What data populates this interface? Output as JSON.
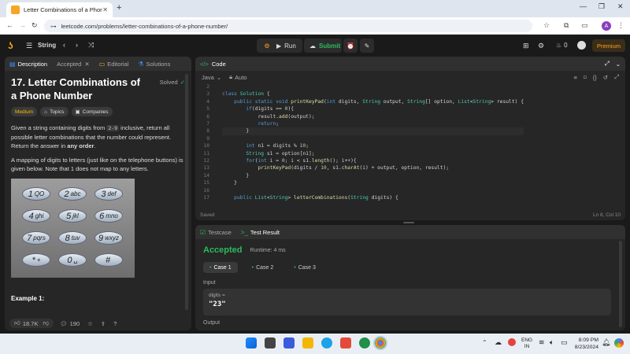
{
  "browser": {
    "tab_title": "Letter Combinations of a Phone",
    "url": "leetcode.com/problems/letter-combinations-of-a-phone-number/"
  },
  "nav": {
    "problem_list": "String",
    "run": "Run",
    "submit": "Submit",
    "streak": "0",
    "premium": "Premium",
    "avatar": "A"
  },
  "left_tabs": [
    "Description",
    "Accepted",
    "Editorial",
    "Solutions"
  ],
  "problem": {
    "title": "17. Letter Combinations of a Phone Number",
    "status": "Solved",
    "difficulty": "Medium",
    "topics": "Topics",
    "companies": "Companies",
    "p1a": "Given a string containing digits from ",
    "p1code": "2-9",
    "p1b": " inclusive, return all possible letter combinations that the number could represent. Return the answer in ",
    "p1c": "any order",
    "p1d": ".",
    "p2": "A mapping of digits to letters (just like on the telephone buttons) is given below. Note that 1 does not map to any letters.",
    "example": "Example 1:"
  },
  "keypad": [
    [
      "1",
      "QO"
    ],
    [
      "2",
      "abc"
    ],
    [
      "3",
      "def"
    ],
    [
      "4",
      "ghi"
    ],
    [
      "5",
      "jkl"
    ],
    [
      "6",
      "mno"
    ],
    [
      "7",
      "pqrs"
    ],
    [
      "8",
      "tuv"
    ],
    [
      "9",
      "wxyz"
    ],
    [
      "*",
      "+"
    ],
    [
      "0",
      "␣"
    ],
    [
      "#",
      ""
    ]
  ],
  "footer": {
    "likes": "18.7K",
    "comments": "190"
  },
  "code_panel": {
    "title": "Code",
    "language": "Java",
    "mode": "Auto",
    "saved": "Saved",
    "cursor": "Ln 8, Col 10"
  },
  "code_lines": [
    {
      "n": "2",
      "t": ""
    },
    {
      "n": "3",
      "t": "class Solution {"
    },
    {
      "n": "4",
      "t": "    public static void printKeyPad(int digits, String output, String[] option, List<String> result) {"
    },
    {
      "n": "5",
      "t": "        if(digits == 0){"
    },
    {
      "n": "6",
      "t": "            result.add(output);"
    },
    {
      "n": "7",
      "t": "            return;"
    },
    {
      "n": "8",
      "t": "        }"
    },
    {
      "n": "9",
      "t": ""
    },
    {
      "n": "10",
      "t": "        int n1 = digits % 10;"
    },
    {
      "n": "11",
      "t": "        String s1 = option[n1];"
    },
    {
      "n": "12",
      "t": "        for(int i = 0; i < s1.length(); i++){"
    },
    {
      "n": "13",
      "t": "            printKeyPad(digits / 10, s1.charAt(i) + output, option, result);"
    },
    {
      "n": "14",
      "t": "        }"
    },
    {
      "n": "15",
      "t": "    }"
    },
    {
      "n": "16",
      "t": ""
    },
    {
      "n": "17",
      "t": "    public List<String> letterCombinations(String digits) {"
    }
  ],
  "test": {
    "tab1": "Testcase",
    "tab2": "Test Result",
    "verdict": "Accepted",
    "runtime": "Runtime: 4 ms",
    "cases": [
      "Case 1",
      "Case 2",
      "Case 3"
    ],
    "input_label": "Input",
    "var": "digits =",
    "value": "\"23\"",
    "output_label": "Output"
  },
  "tray": {
    "lang1": "ENG",
    "lang2": "IN",
    "time": "8:09 PM",
    "date": "8/23/2024"
  },
  "colors": {
    "accent": "#2cbb5d",
    "orange": "#ffa116",
    "medium": "#ffb800"
  }
}
